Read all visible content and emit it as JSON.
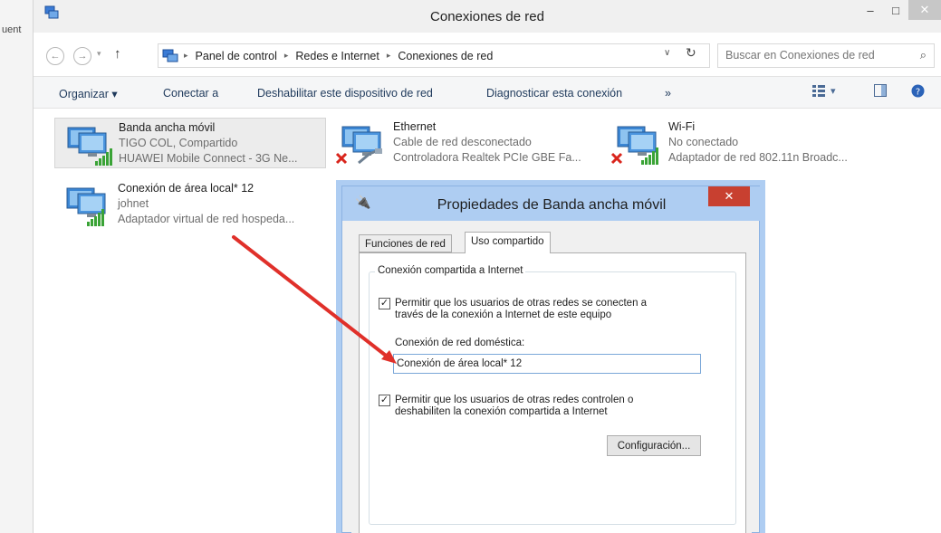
{
  "background_window": {
    "partial_text": "uent"
  },
  "window": {
    "title": "Conexiones de red",
    "controls": {
      "minimize": "–",
      "maximize": "□",
      "close": "✕"
    }
  },
  "navigation": {
    "back": "←",
    "forward": "→",
    "dropdown": "▾",
    "up": "↑"
  },
  "breadcrumb": [
    "Panel de control",
    "Redes e Internet",
    "Conexiones de red"
  ],
  "breadcrumb_separator": "▸",
  "address_controls": {
    "dropdown": "∨",
    "refresh": "↻"
  },
  "search": {
    "placeholder": "Buscar en Conexiones de red"
  },
  "toolbar": {
    "organize": "Organizar ▾",
    "connect": "Conectar a",
    "disable": "Deshabilitar este dispositivo de red",
    "diagnose": "Diagnosticar esta conexión",
    "more": "»",
    "view_menu": "▾"
  },
  "connections": [
    {
      "name": "Banda ancha móvil",
      "status": "TIGO COL, Compartido",
      "adapter": "HUAWEI Mobile Connect - 3G Ne...",
      "disconnected": false,
      "selected": true
    },
    {
      "name": "Ethernet",
      "status": "Cable de red desconectado",
      "adapter": "Controladora Realtek PCIe GBE Fa...",
      "disconnected": true,
      "selected": false
    },
    {
      "name": "Wi-Fi",
      "status": "No conectado",
      "adapter": "Adaptador de red 802.11n Broadc...",
      "disconnected": true,
      "selected": false
    },
    {
      "name": "Conexión de área local* 12",
      "status": "johnet",
      "adapter": "Adaptador virtual de red hospeda...",
      "disconnected": false,
      "selected": false
    }
  ],
  "dialog": {
    "title": "Propiedades de Banda ancha móvil",
    "close": "✕",
    "tabs": [
      "Funciones de red",
      "Uso compartido"
    ],
    "active_tab": "Uso compartido",
    "group_title": "Conexión compartida a Internet",
    "allow_connect": {
      "checked": true,
      "line1": "Permitir que los usuarios de otras redes se conecten a",
      "line2": "través de la conexión a Internet de este equipo"
    },
    "home_network_label": "Conexión de red doméstica:",
    "home_network_value": "Conexión de área local* 12",
    "allow_control": {
      "checked": true,
      "line1": "Permitir que los usuarios de otras redes controlen o",
      "line2": "deshabiliten la conexión compartida a Internet"
    },
    "settings_button": "Configuración..."
  },
  "colors": {
    "toolbar_text": "#1e395b",
    "dialog_frame": "#aecdf2",
    "dialog_close": "#c84030",
    "annotation_arrow": "#e0302a",
    "disconnected_x": "#d9251c"
  }
}
